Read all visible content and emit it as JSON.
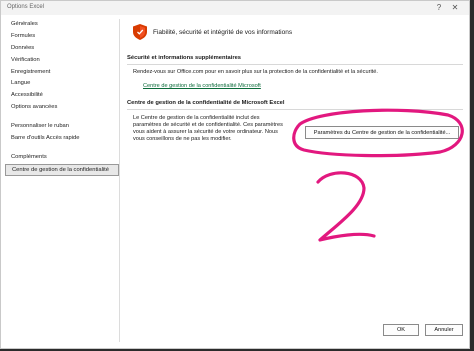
{
  "window": {
    "title": "Options Excel",
    "help": "?",
    "close": "✕"
  },
  "sidebar": {
    "items": [
      {
        "label": "Générales"
      },
      {
        "label": "Formules"
      },
      {
        "label": "Données"
      },
      {
        "label": "Vérification"
      },
      {
        "label": "Enregistrement"
      },
      {
        "label": "Langue"
      },
      {
        "label": "Accessibilité"
      },
      {
        "label": "Options avancées"
      },
      {
        "label": "Personnaliser le ruban"
      },
      {
        "label": "Barre d'outils Accès rapide"
      },
      {
        "label": "Compléments"
      },
      {
        "label": "Centre de gestion de la confidentialité"
      }
    ],
    "selected": "Centre de gestion de la confidentialité"
  },
  "main": {
    "header": "Fiabilité, sécurité et intégrité de vos informations",
    "security_section": {
      "title": "Sécurité et informations supplémentaires",
      "text": "Rendez-vous sur Office.com pour en savoir plus sur la protection de la confidentialité et la sécurité.",
      "link": "Centre de gestion de la confidentialité Microsoft"
    },
    "trust_center_section": {
      "title": "Centre de gestion de la confidentialité de Microsoft Excel",
      "line1": "Le Centre de gestion de la confidentialité inclut des",
      "line2": "paramètres de sécurité et de confidentialité. Ces paramètres",
      "line3": "vous aident à assurer la sécurité de votre ordinateur. Nous",
      "line4": "vous conseillons de ne pas les modifier.",
      "button": "Paramètres du Centre de gestion de la confidentialité..."
    }
  },
  "footer": {
    "ok": "OK",
    "cancel": "Annuler"
  },
  "colors": {
    "annotation_ink": "#e2187f",
    "shield_red": "#d83b01",
    "link_green": "#0b6b3a"
  }
}
